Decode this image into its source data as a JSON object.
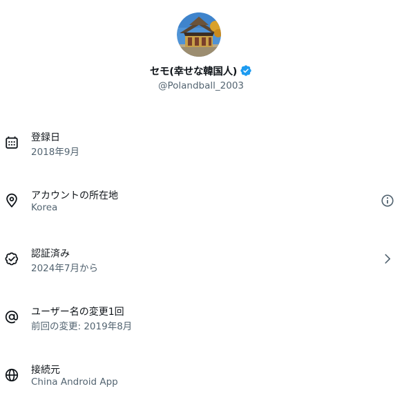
{
  "profile": {
    "display_name": "セモ(幸せな韓国人)",
    "handle": "@Polandball_2003",
    "verified": true
  },
  "info_rows": [
    {
      "icon": "calendar-icon",
      "label": "登録日",
      "value": "2018年9月",
      "action": null
    },
    {
      "icon": "location-pin-icon",
      "label": "アカウントの所在地",
      "value": "Korea",
      "action": "info-icon"
    },
    {
      "icon": "verified-check-icon",
      "label": "認証済み",
      "value": "2024年7月から",
      "action": "chevron-right-icon"
    },
    {
      "icon": "at-sign-icon",
      "label": "ユーザー名の変更1回",
      "value": "前回の変更: 2019年8月",
      "action": null
    },
    {
      "icon": "globe-icon",
      "label": "接続元",
      "value": "China Android App",
      "action": null
    }
  ],
  "colors": {
    "primary_text": "#0f1419",
    "secondary_text": "#536471",
    "verified_blue": "#1d9bf0"
  }
}
